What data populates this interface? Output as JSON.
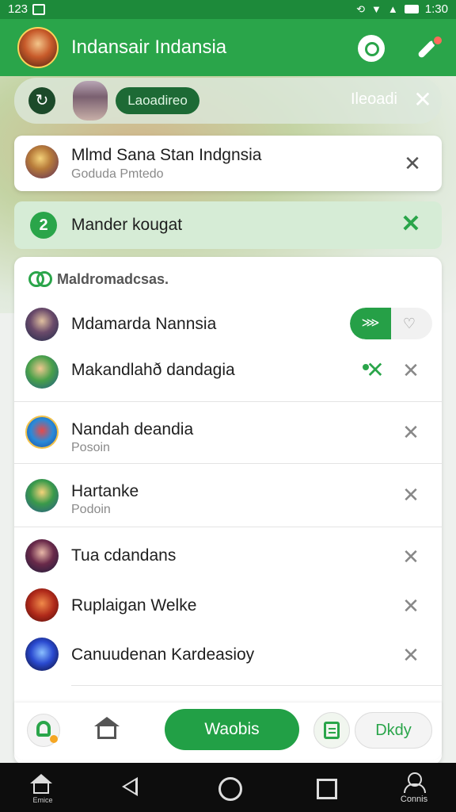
{
  "status_bar": {
    "left_text": "123",
    "time": "1:30"
  },
  "app_bar": {
    "title": "Indansair Indansia"
  },
  "search_strip": {
    "pill_label": "Laoadireo",
    "right_text": "Ileoadi",
    "refresh_glyph": "↻"
  },
  "featured_card": {
    "title": "Mlmd Sana Stan  Indgnsia",
    "subtitle": "Goduda Pmtedo"
  },
  "mandatory_bar": {
    "number": "2",
    "text": "Mander kougat"
  },
  "list": {
    "section_label": "Maldromadcsas.",
    "toggle": {
      "left_label": "⋙",
      "right_label": "♡"
    },
    "items": [
      {
        "title": "Mdamarda Nannsia",
        "subtitle": ""
      },
      {
        "title": "Makandlahð dandagia",
        "subtitle": ""
      },
      {
        "title": "Nandah deandia",
        "subtitle": "Posoin"
      },
      {
        "title": "Hartanke",
        "subtitle": "Podoin"
      },
      {
        "title": "Tua cdandans",
        "subtitle": ""
      },
      {
        "title": "Ruplaigan Welke",
        "subtitle": ""
      },
      {
        "title": "Canuudenan Kardeasioy",
        "subtitle": ""
      }
    ]
  },
  "toolbar": {
    "primary_label": "Waobis",
    "secondary_label": "Dkdy"
  },
  "nav_bar": {
    "home_label": "Emice",
    "account_label": "Connis"
  },
  "colors": {
    "primary": "#2aa54a",
    "status": "#1d8a3a",
    "nav": "#0d0d0d"
  },
  "icons": [
    "refresh-icon",
    "close-icon",
    "chat-icon",
    "edit-icon",
    "bell-icon",
    "home-icon",
    "list-icon",
    "back-icon",
    "account-icon"
  ]
}
